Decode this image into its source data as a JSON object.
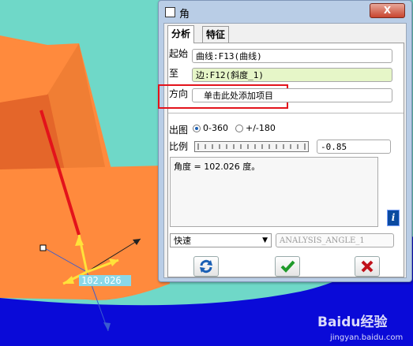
{
  "dialog": {
    "title": "角",
    "close_label": "X",
    "tabs": [
      "分析",
      "特征"
    ],
    "rows": {
      "start_label": "起始",
      "start_value": "曲线:F13(曲线)",
      "to_label": "至",
      "to_value": "边:F12(斜度_1)",
      "direction_label": "方向",
      "direction_value": "单击此处添加项目"
    },
    "output_label": "出图",
    "radio_options": [
      "0-360",
      "+/-180"
    ],
    "ratio_label": "比例",
    "ratio_value": "-0.85",
    "result_text": "角度 = 102.026 度。",
    "mode_select": "快速",
    "analysis_name": "ANALYSIS_ANGLE_1",
    "info_icon": "info-icon"
  },
  "viewport": {
    "measure_label": "102.026"
  },
  "watermark": {
    "brand": "Baidu经验",
    "url": "jingyan.baidu.com"
  },
  "colors": {
    "background_cyan": "#6fd8c8",
    "part_orange": "#ff8a3d",
    "base_blue": "#0a0ad8",
    "highlight_red": "#e3131b",
    "dialog_frame": "#b9cde6"
  }
}
